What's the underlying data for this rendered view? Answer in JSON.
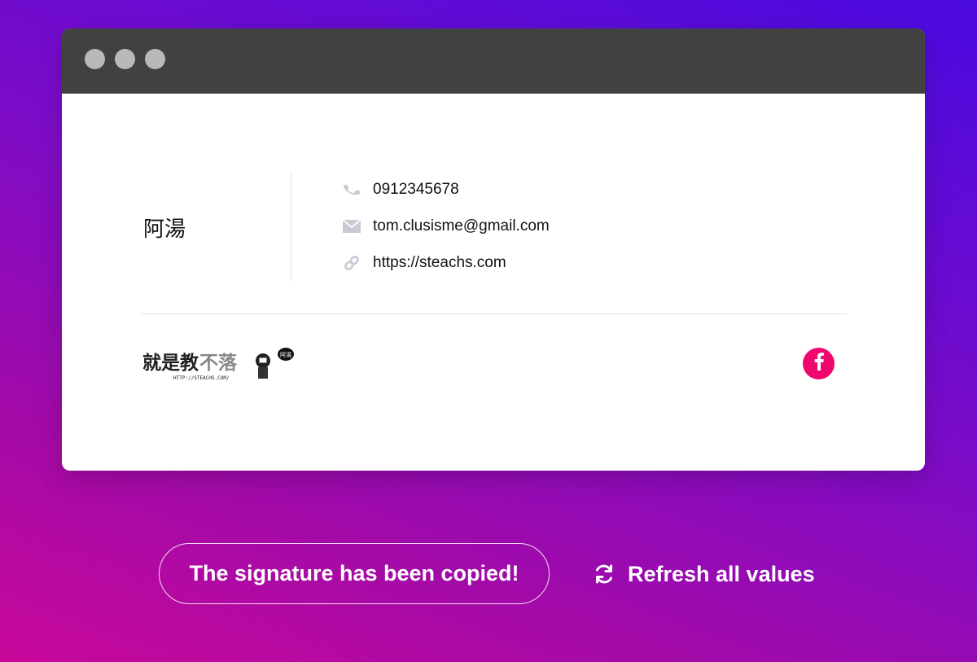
{
  "signature": {
    "name": "阿湯",
    "phone": "0912345678",
    "email": "tom.clusisme@gmail.com",
    "website": "https://steachs.com",
    "icons": {
      "phone": "phone-icon",
      "email": "mail-icon",
      "website": "link-icon"
    }
  },
  "logo": {
    "text": "就是教不落",
    "url_text": "HTTP://STEACHS.COM/",
    "bubble_text": "阿湯"
  },
  "social": {
    "facebook_icon": "facebook-icon",
    "color": "#f0076d"
  },
  "actions": {
    "copied_label": "The signature has been copied!",
    "refresh_label": "Refresh all values",
    "refresh_icon": "refresh-icon"
  },
  "window": {
    "titlebar_color": "#414141",
    "traffic_dots": 3
  }
}
